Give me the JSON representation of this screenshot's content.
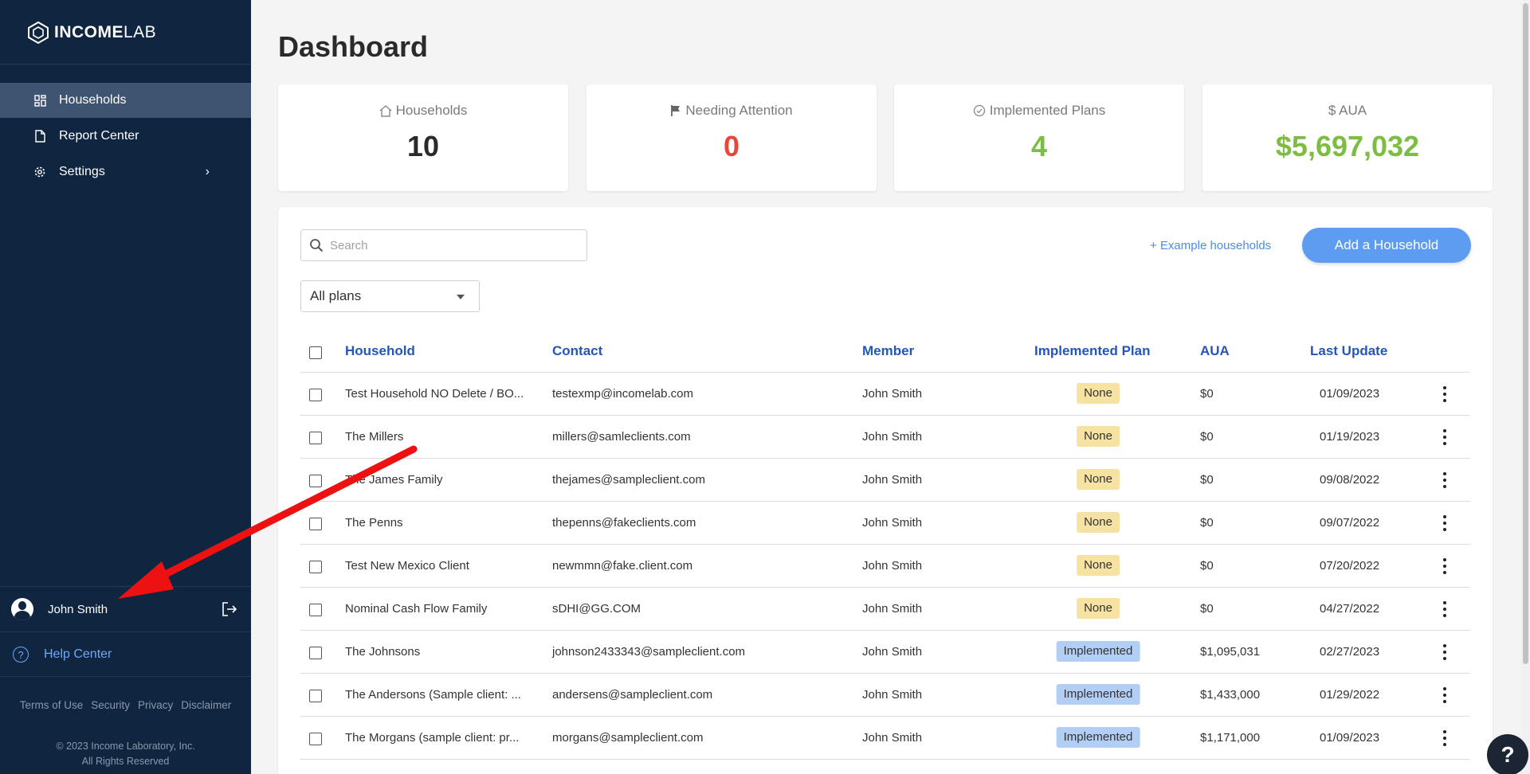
{
  "app": {
    "logo_bold": "INCOME",
    "logo_light": "LAB"
  },
  "sidebar": {
    "items": [
      {
        "label": "Households",
        "icon": "grid-icon"
      },
      {
        "label": "Report Center",
        "icon": "document-icon"
      },
      {
        "label": "Settings",
        "icon": "gear-icon",
        "chevron": "›"
      }
    ],
    "user_name": "John Smith",
    "help_label": "Help Center",
    "footer_links": [
      "Terms of Use",
      "Security",
      "Privacy",
      "Disclaimer"
    ],
    "copyright_line1": "© 2023 Income Laboratory, Inc.",
    "copyright_line2": "All Rights Reserved"
  },
  "main": {
    "title": "Dashboard",
    "stats": [
      {
        "label": "Households",
        "value": "10",
        "color": "#2a2a2a",
        "icon": "house-icon"
      },
      {
        "label": "Needing Attention",
        "value": "0",
        "color": "#e8463a",
        "icon": "flag-icon"
      },
      {
        "label": "Implemented Plans",
        "value": "4",
        "color": "#7cbd42",
        "icon": "check-circle-icon"
      },
      {
        "label": "$ AUA",
        "value": "$5,697,032",
        "color": "#7cbd42",
        "icon": ""
      }
    ],
    "search_placeholder": "Search",
    "example_link": "+ Example households",
    "add_button": "Add a Household",
    "plans_filter": "All plans",
    "columns": [
      "Household",
      "Contact",
      "Member",
      "Implemented Plan",
      "AUA",
      "Last Update"
    ],
    "rows": [
      {
        "household": "Test Household NO Delete / BO...",
        "contact": "testexmp@incomelab.com",
        "member": "John Smith",
        "plan": "None",
        "aua": "$0",
        "updated": "01/09/2023"
      },
      {
        "household": "The Millers",
        "contact": "millers@samleclients.com",
        "member": "John Smith",
        "plan": "None",
        "aua": "$0",
        "updated": "01/19/2023"
      },
      {
        "household": "The James Family",
        "contact": "thejames@sampleclient.com",
        "member": "John Smith",
        "plan": "None",
        "aua": "$0",
        "updated": "09/08/2022"
      },
      {
        "household": "The Penns",
        "contact": "thepenns@fakeclients.com",
        "member": "John Smith",
        "plan": "None",
        "aua": "$0",
        "updated": "09/07/2022"
      },
      {
        "household": "Test New Mexico Client",
        "contact": "newmmn@fake.client.com",
        "member": "John Smith",
        "plan": "None",
        "aua": "$0",
        "updated": "07/20/2022"
      },
      {
        "household": "Nominal Cash Flow Family",
        "contact": "sDHI@GG.COM",
        "member": "John Smith",
        "plan": "None",
        "aua": "$0",
        "updated": "04/27/2022"
      },
      {
        "household": "The Johnsons",
        "contact": "johnson2433343@sampleclient.com",
        "member": "John Smith",
        "plan": "Implemented",
        "aua": "$1,095,031",
        "updated": "02/27/2023"
      },
      {
        "household": "The Andersons (Sample client: ...",
        "contact": "andersens@sampleclient.com",
        "member": "John Smith",
        "plan": "Implemented",
        "aua": "$1,433,000",
        "updated": "01/29/2022"
      },
      {
        "household": "The Morgans (sample client: pr...",
        "contact": "morgans@sampleclient.com",
        "member": "John Smith",
        "plan": "Implemented",
        "aua": "$1,171,000",
        "updated": "01/09/2023"
      }
    ]
  },
  "help_fab": "?",
  "annotation_color": "#ee1111"
}
